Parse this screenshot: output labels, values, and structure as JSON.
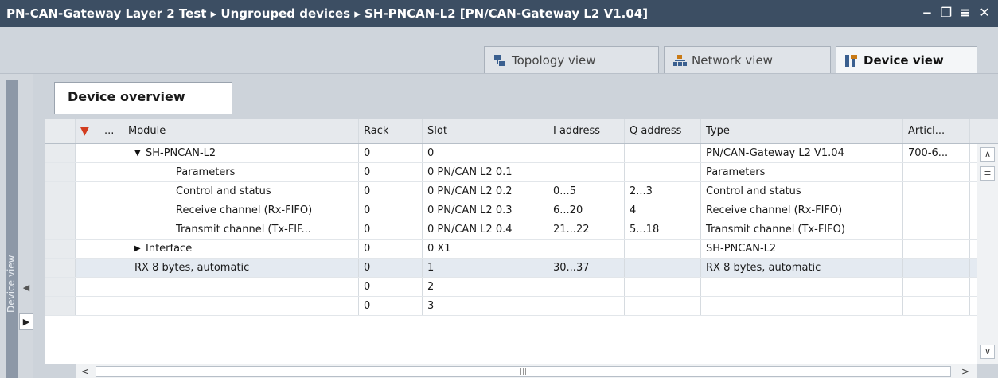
{
  "window": {
    "title": "PN-CAN-Gateway Layer 2 Test ▸ Ungrouped devices ▸ SH-PNCAN-L2 [PN/CAN-Gateway L2 V1.04]",
    "controls": [
      "‒",
      "❐",
      "≡",
      "✕"
    ]
  },
  "views": {
    "topology": "Topology view",
    "network": "Network view",
    "device": "Device view"
  },
  "side_panel": {
    "label": "Device view"
  },
  "overview": {
    "tab": "Device overview",
    "headers": {
      "col1": "",
      "col2": "...",
      "module": "Module",
      "rack": "Rack",
      "slot": "Slot",
      "i_address": "I address",
      "q_address": "Q address",
      "type": "Type",
      "article": "Articl..."
    },
    "rows": [
      {
        "module": "SH-PNCAN-L2",
        "rack": "0",
        "slot": "0",
        "i": "",
        "q": "",
        "type": "PN/CAN-Gateway L2 V1.04",
        "article": "700-6...",
        "tree": "▼"
      },
      {
        "module": "Parameters",
        "rack": "0",
        "slot": "0 PN/CAN L2 0.1",
        "i": "",
        "q": "",
        "type": "Parameters",
        "article": ""
      },
      {
        "module": "Control and status",
        "rack": "0",
        "slot": "0 PN/CAN L2 0.2",
        "i": "0...5",
        "q": "2...3",
        "type": "Control and status",
        "article": ""
      },
      {
        "module": "Receive channel (Rx-FIFO)",
        "rack": "0",
        "slot": "0 PN/CAN L2 0.3",
        "i": "6...20",
        "q": "4",
        "type": "Receive channel (Rx-FIFO)",
        "article": ""
      },
      {
        "module": "Transmit channel (Tx-FIF...",
        "rack": "0",
        "slot": "0 PN/CAN L2 0.4",
        "i": "21...22",
        "q": "5...18",
        "type": "Transmit channel (Tx-FIFO)",
        "article": ""
      },
      {
        "module": "Interface",
        "rack": "0",
        "slot": "0 X1",
        "i": "",
        "q": "",
        "type": "SH-PNCAN-L2",
        "article": "",
        "tree": "▶"
      },
      {
        "module": "RX 8 bytes, automatic",
        "rack": "0",
        "slot": "1",
        "i": "30...37",
        "q": "",
        "type": "RX 8 bytes, automatic",
        "article": ""
      },
      {
        "module": "",
        "rack": "0",
        "slot": "2",
        "i": "",
        "q": "",
        "type": "",
        "article": ""
      },
      {
        "module": "",
        "rack": "0",
        "slot": "3",
        "i": "",
        "q": "",
        "type": "",
        "article": ""
      }
    ]
  },
  "scroll": {
    "up": "∧",
    "down": "∨",
    "left": "<",
    "right": ">",
    "grip": "|||",
    "vgrip": "≡"
  }
}
